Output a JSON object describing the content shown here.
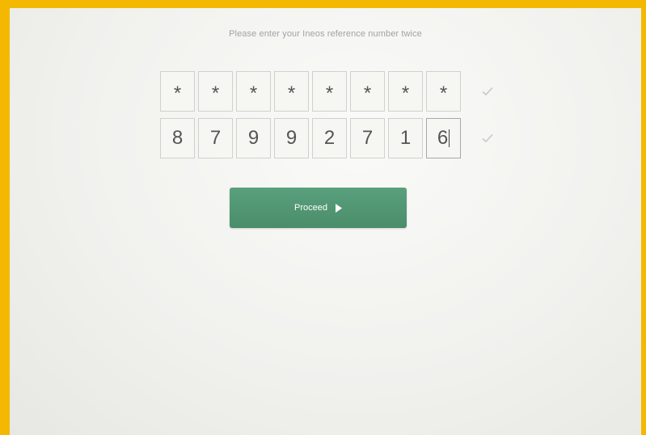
{
  "instruction": "Please enter your Ineos reference number twice",
  "entry_masked": [
    "*",
    "*",
    "*",
    "*",
    "*",
    "*",
    "*",
    "*"
  ],
  "entry_confirm": [
    "8",
    "7",
    "9",
    "9",
    "2",
    "7",
    "1",
    "6"
  ],
  "proceed_label": "Proceed",
  "icons": {
    "row_valid": "checkmark-icon",
    "button": "play-arrow-icon"
  },
  "colors": {
    "frame": "#f5b800",
    "button": "#4f946f",
    "check": "#c8c8c8"
  }
}
